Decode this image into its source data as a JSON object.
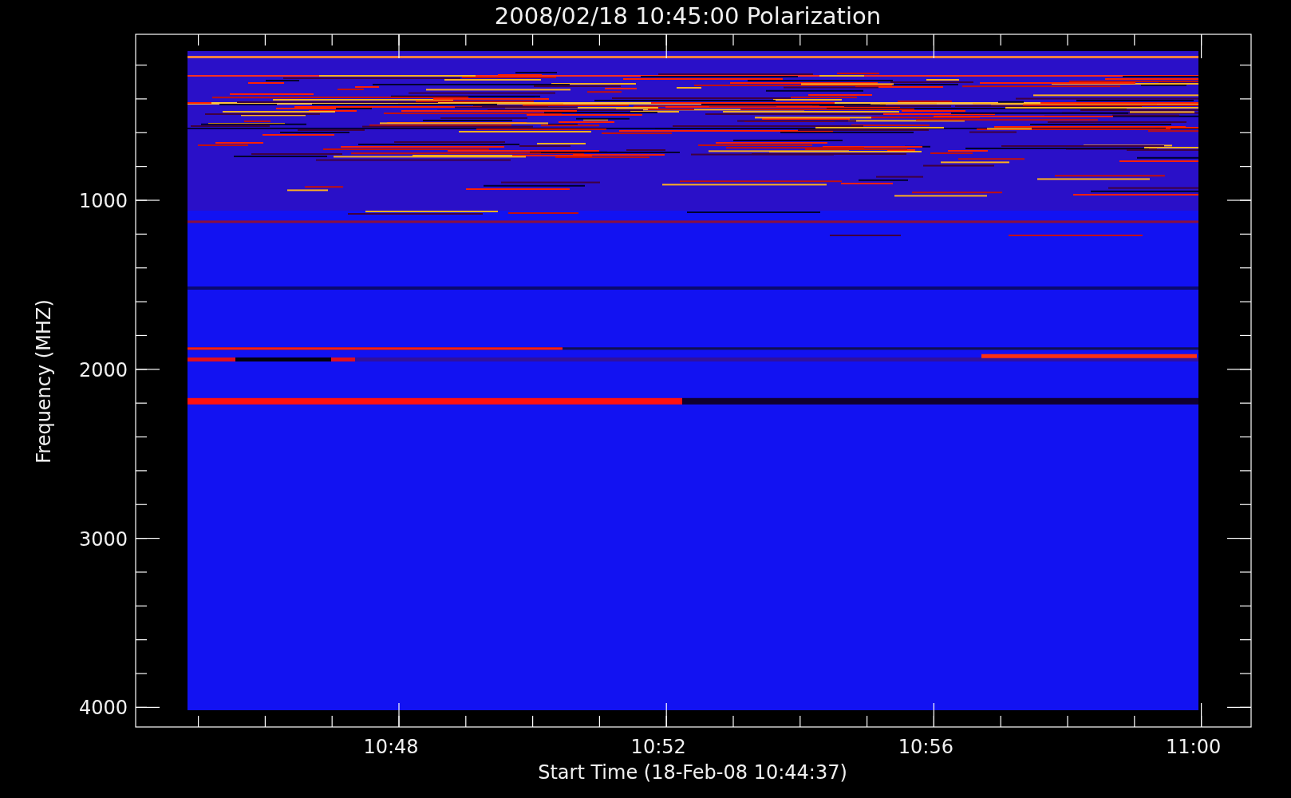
{
  "title": "2008/02/18 10:45:00 Polarization",
  "y_axis": {
    "label": "Frequency (MHZ)",
    "ticks": [
      "1000",
      "2000",
      "3000",
      "4000"
    ]
  },
  "x_axis": {
    "label": "Start Time (18-Feb-08 10:44:37)",
    "ticks": [
      "10:48",
      "10:52",
      "10:56",
      "11:00"
    ]
  }
}
